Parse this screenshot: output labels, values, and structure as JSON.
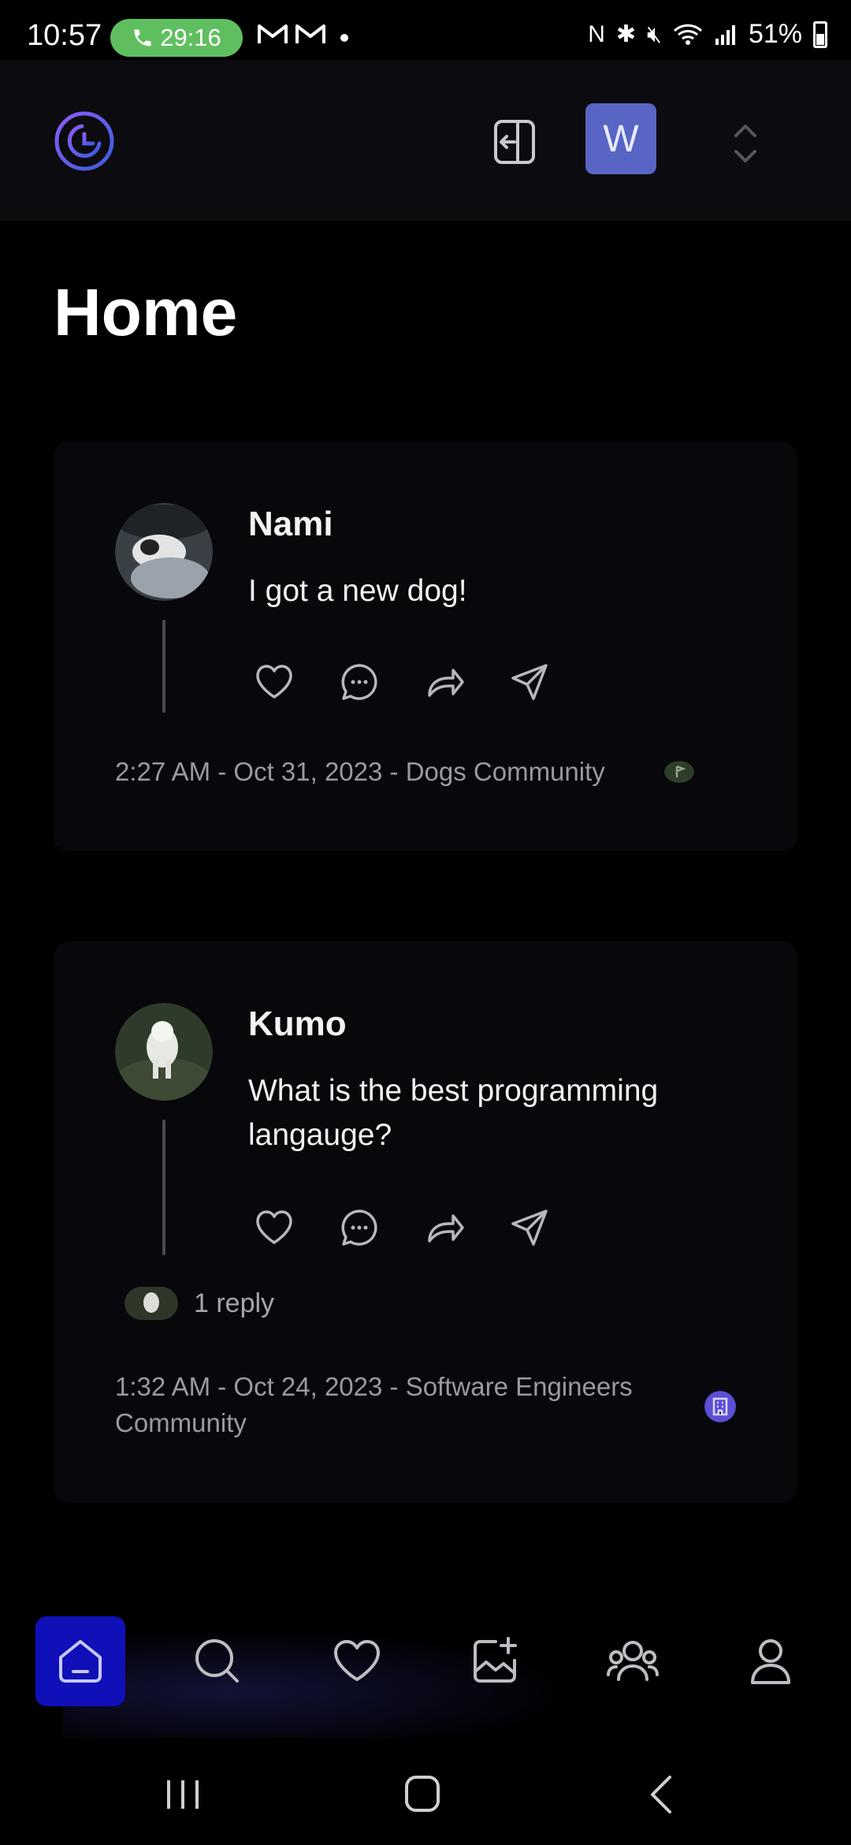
{
  "status_bar": {
    "time": "10:57",
    "call_timer": "29:16",
    "mail_icons": [
      "gmail-icon",
      "gmail-icon"
    ],
    "battery": "51%"
  },
  "top_bar": {
    "logo_icon": "clock-moon-logo",
    "switch_icon": "logout-icon",
    "community_initial": "W",
    "expand_icon": "chevron-updown-icon"
  },
  "page": {
    "title": "Home"
  },
  "posts": [
    {
      "author": "Nami",
      "text": "I got a new dog!",
      "timestamp": "2:27 AM - Oct 31, 2023 - Dogs Community",
      "replies_label": ""
    },
    {
      "author": "Kumo",
      "text": "What is the best programming langauge?",
      "timestamp": "1:32 AM - Oct 24, 2023 - Software Engineers Community",
      "replies_label": "1 reply"
    }
  ],
  "bottom_nav": {
    "items": [
      "home-icon",
      "search-icon",
      "heart-icon",
      "create-image-icon",
      "community-icon",
      "profile-icon"
    ],
    "active": "home-icon"
  },
  "colors": {
    "accent": "#1010b8",
    "avatar_w": "#5865c4",
    "card_bg": "#07070c",
    "meta_text": "#9a9aa2"
  }
}
